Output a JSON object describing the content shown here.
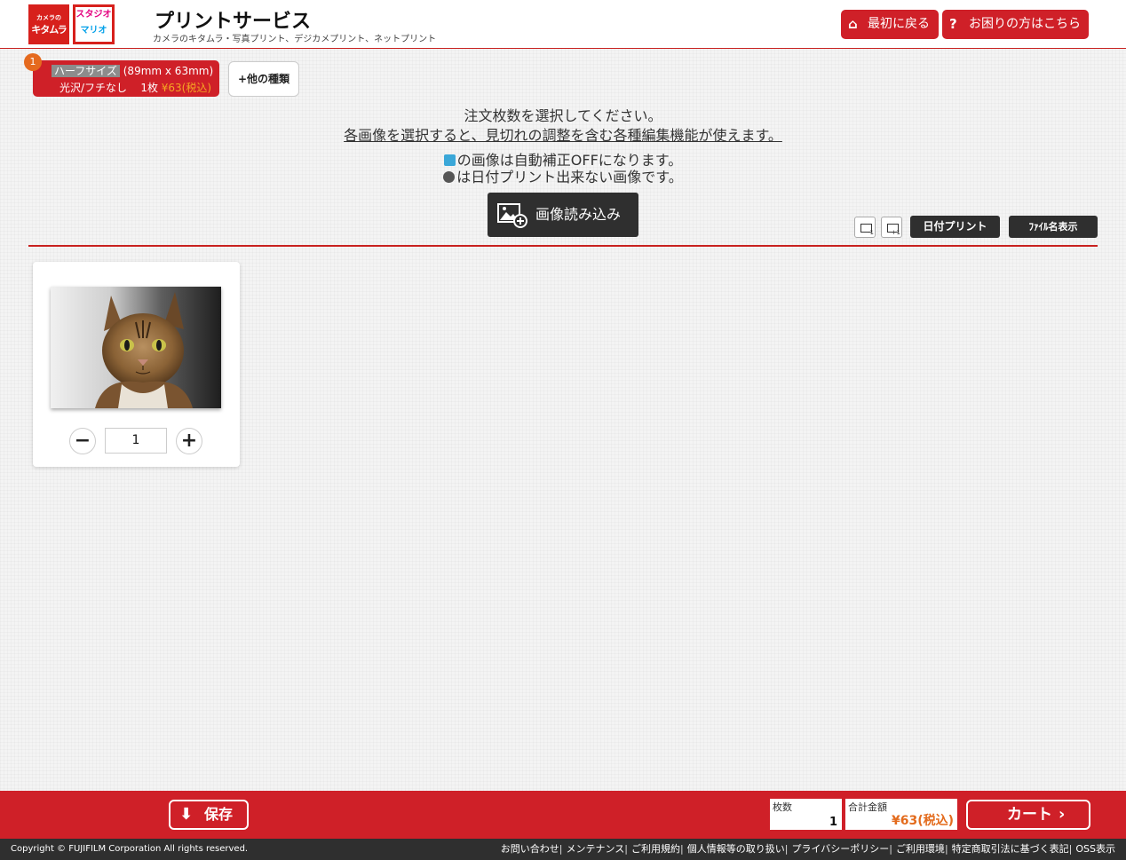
{
  "header": {
    "logo_kitamura_small": "カメラの",
    "logo_kitamura_big": "キタムラ",
    "logo_mario_line1": "スタジオ",
    "logo_mario_line2": "マリオ",
    "title": "プリントサービス",
    "subtitle": "カメラのキタムラ・写真プリント、デジカメプリント、ネットプリント",
    "home_button": "最初に戻る",
    "help_button": "お困りの方はこちら"
  },
  "size_tab": {
    "badge": "1",
    "size_name": "ハーフサイズ",
    "size_dims": "(89mm x 63mm)",
    "finish": "光沢/フチなし",
    "count": "1枚",
    "price": "¥63(税込)"
  },
  "other_types_button": "+他の種類",
  "instructions": {
    "line1": "注文枚数を選択してください。",
    "line2": "各画像を選択すると、見切れの調整を含む各種編集機能が使えます。",
    "line3": "の画像は自動補正OFFになります。",
    "line4": "は日付プリント出来ない画像です。"
  },
  "import_button": "画像読み込み",
  "toolbar": {
    "minus_label": "-1",
    "plus_label": "+1",
    "date_print": "日付プリント",
    "filename_display": "ﾌｧｲﾙ名表示"
  },
  "photo_card": {
    "quantity": "1",
    "minus_glyph": "−",
    "plus_glyph": "+"
  },
  "footer": {
    "save_button": "保存",
    "count_label": "枚数",
    "count_value": "1",
    "total_label": "合計金額",
    "total_value": "¥63(税込)",
    "cart_button": "カート"
  },
  "copyright": "Copyright © FUJIFILM Corporation All rights reserved.",
  "footer_links": [
    "お問い合わせ",
    "メンテナンス",
    "ご利用規約",
    "個人情報等の取り扱い",
    "プライバシーポリシー",
    "ご利用環境",
    "特定商取引法に基づく表記",
    "OSS表示"
  ],
  "colors": {
    "brand_red": "#cf2028",
    "dark_button": "#2f2f2f",
    "price_orange": "#e36b1d"
  }
}
